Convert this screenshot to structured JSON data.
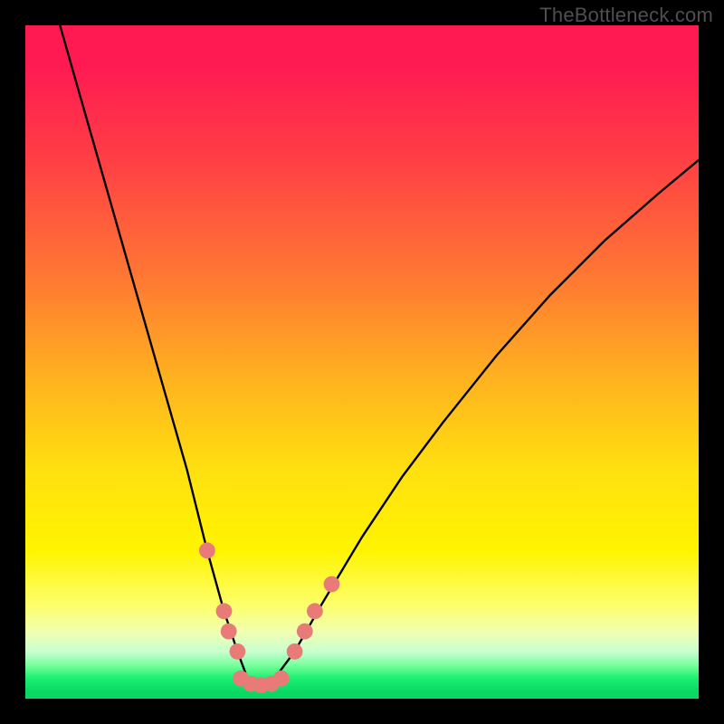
{
  "watermark": {
    "text": "TheBottleneck.com"
  },
  "chart_data": {
    "type": "line",
    "title": "",
    "xlabel": "",
    "ylabel": "",
    "xlim": [
      0,
      100
    ],
    "ylim": [
      0,
      100
    ],
    "grid": false,
    "legend": false,
    "background_gradient": {
      "top": "#ff1a52",
      "middle": "#fff400",
      "bottom": "#0ad865"
    },
    "series": [
      {
        "name": "bottleneck-curve",
        "color": "#000000",
        "x": [
          4,
          8,
          12,
          16,
          20,
          24,
          27,
          29.5,
          31.5,
          33,
          35,
          37,
          40,
          44,
          50,
          56,
          62,
          70,
          78,
          86,
          94,
          100
        ],
        "values": [
          104,
          90,
          76,
          62,
          48,
          34,
          22,
          13,
          7,
          3,
          1,
          3,
          7,
          14,
          24,
          33,
          41,
          51,
          60,
          68,
          75,
          80
        ]
      }
    ],
    "markers": [
      {
        "name": "left-dot-1",
        "x": 27.0,
        "y": 22,
        "r": 1.2
      },
      {
        "name": "left-dot-2",
        "x": 29.5,
        "y": 13,
        "r": 1.2
      },
      {
        "name": "left-dot-3",
        "x": 30.2,
        "y": 10,
        "r": 1.2
      },
      {
        "name": "left-dot-4",
        "x": 31.5,
        "y": 7,
        "r": 1.2
      },
      {
        "name": "flat-dot-1",
        "x": 32.0,
        "y": 3.0,
        "r": 1.2
      },
      {
        "name": "flat-dot-2",
        "x": 33.5,
        "y": 2.2,
        "r": 1.2
      },
      {
        "name": "flat-dot-3",
        "x": 35.0,
        "y": 2.0,
        "r": 1.2
      },
      {
        "name": "flat-dot-4",
        "x": 36.5,
        "y": 2.2,
        "r": 1.2
      },
      {
        "name": "flat-dot-5",
        "x": 38.0,
        "y": 3.0,
        "r": 1.2
      },
      {
        "name": "right-dot-1",
        "x": 40.0,
        "y": 7,
        "r": 1.2
      },
      {
        "name": "right-dot-2",
        "x": 41.5,
        "y": 10,
        "r": 1.2
      },
      {
        "name": "right-dot-3",
        "x": 43.0,
        "y": 13,
        "r": 1.2
      },
      {
        "name": "right-dot-4",
        "x": 45.5,
        "y": 17,
        "r": 1.2
      }
    ],
    "marker_style": {
      "color": "#e87b78",
      "stroke": "none"
    }
  }
}
